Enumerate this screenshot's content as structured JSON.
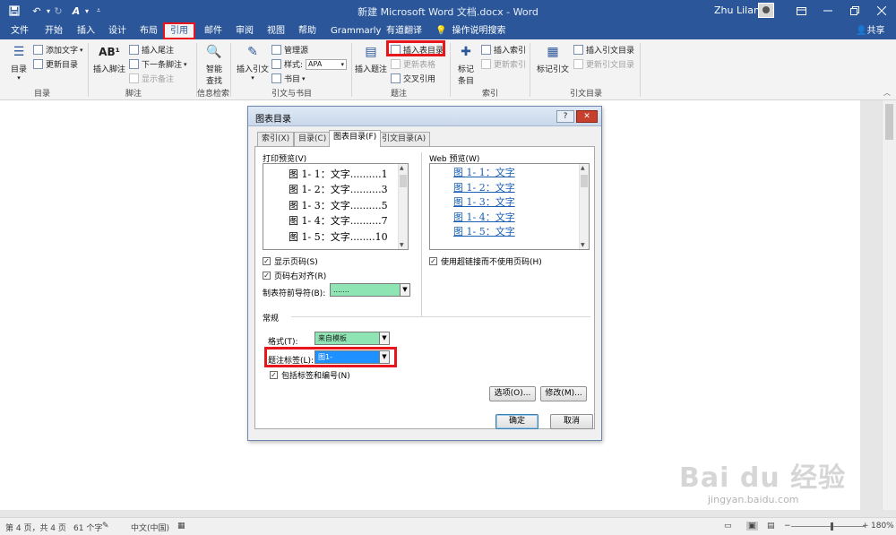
{
  "quick_access": {
    "save_icon": "save-icon",
    "undo_icon": "undo-icon",
    "redo_icon": "redo-icon",
    "format_icon": "text-effects-icon",
    "customize_icon": "chevron-down-icon"
  },
  "window": {
    "title": "新建 Microsoft Word 文档.docx - Word",
    "user_name": "Zhu Lilan"
  },
  "menu_tabs": [
    "文件",
    "开始",
    "插入",
    "设计",
    "布局",
    "引用",
    "邮件",
    "审阅",
    "视图",
    "帮助",
    "Grammarly",
    "有道翻译"
  ],
  "tell_me": "操作说明搜索",
  "share": "共享",
  "ribbon": {
    "groups": {
      "toc": "目录",
      "footnotes": "脚注",
      "research": "信息检索",
      "citations": "引文与书目",
      "captions": "题注",
      "index": "索引",
      "authorities": "引文目录"
    },
    "toc_button": "目录",
    "add_text": "添加文字",
    "update_toc": "更新目录",
    "insert_footnote": "插入脚注",
    "insert_endnote": "插入尾注",
    "next_footnote": "下一条脚注",
    "show_notes": "显示备注",
    "smart_lookup_1": "智能",
    "smart_lookup_2": "查找",
    "insert_citation": "插入引文",
    "manage_sources": "管理源",
    "style_label": "样式:",
    "style_value": "APA",
    "bibliography": "书目",
    "insert_caption": "插入题注",
    "insert_table_of_figures": "插入表目录",
    "update_table": "更新表格",
    "cross_reference": "交叉引用",
    "mark_entry_1": "标记",
    "mark_entry_2": "条目",
    "insert_index": "插入索引",
    "update_index": "更新索引",
    "mark_citation": "标记引文",
    "insert_toa": "插入引文目录",
    "update_toa": "更新引文目录",
    "footnote_icon_text": "AB¹"
  },
  "dialog": {
    "title": "图表目录",
    "help": "?",
    "close": "✕",
    "tabs": [
      "索引(X)",
      "目录(C)",
      "图表目录(F)",
      "引文目录(A)"
    ],
    "print_preview_label": "打印预览(V)",
    "print_preview_rows": [
      "图 1- 1：文字..........1",
      "图 1- 2：文字..........3",
      "图 1- 3：文字..........5",
      "图 1- 4：文字..........7",
      "图 1- 5：文字........10"
    ],
    "web_preview_label": "Web 预览(W)",
    "web_preview_rows": [
      "图 1- 1：文字",
      "图 1- 2：文字",
      "图 1- 3：文字",
      "图 1- 4：文字",
      "图 1- 5：文字"
    ],
    "show_page_numbers": "显示页码(S)",
    "right_align": "页码右对齐(R)",
    "tab_leader_label": "制表符前导符(B):",
    "tab_leader_value": ".......",
    "use_hyperlinks": "使用超链接而不使用页码(H)",
    "general_label": "常规",
    "formats_label": "格式(T):",
    "formats_value": "来自模板",
    "caption_label_label": "题注标签(L):",
    "caption_label_value": "图1-",
    "include_label": "包括标签和编号(N)",
    "options_button": "选项(O)...",
    "modify_button": "修改(M)...",
    "ok_button": "确定",
    "cancel_button": "取消",
    "check_mark": "✓"
  },
  "status": {
    "page": "第 4 页，共 4 页",
    "words": "61 个字",
    "language": "中文(中国)",
    "zoom": "180%"
  },
  "watermark": {
    "brand": "Bai du 经验",
    "url": "jingyan.baidu.com"
  },
  "colors": {
    "word_blue": "#2b579a",
    "highlight_red": "#e8151d",
    "leader_green": "#8fe4b4",
    "caption_selected": "#1e90ff"
  }
}
